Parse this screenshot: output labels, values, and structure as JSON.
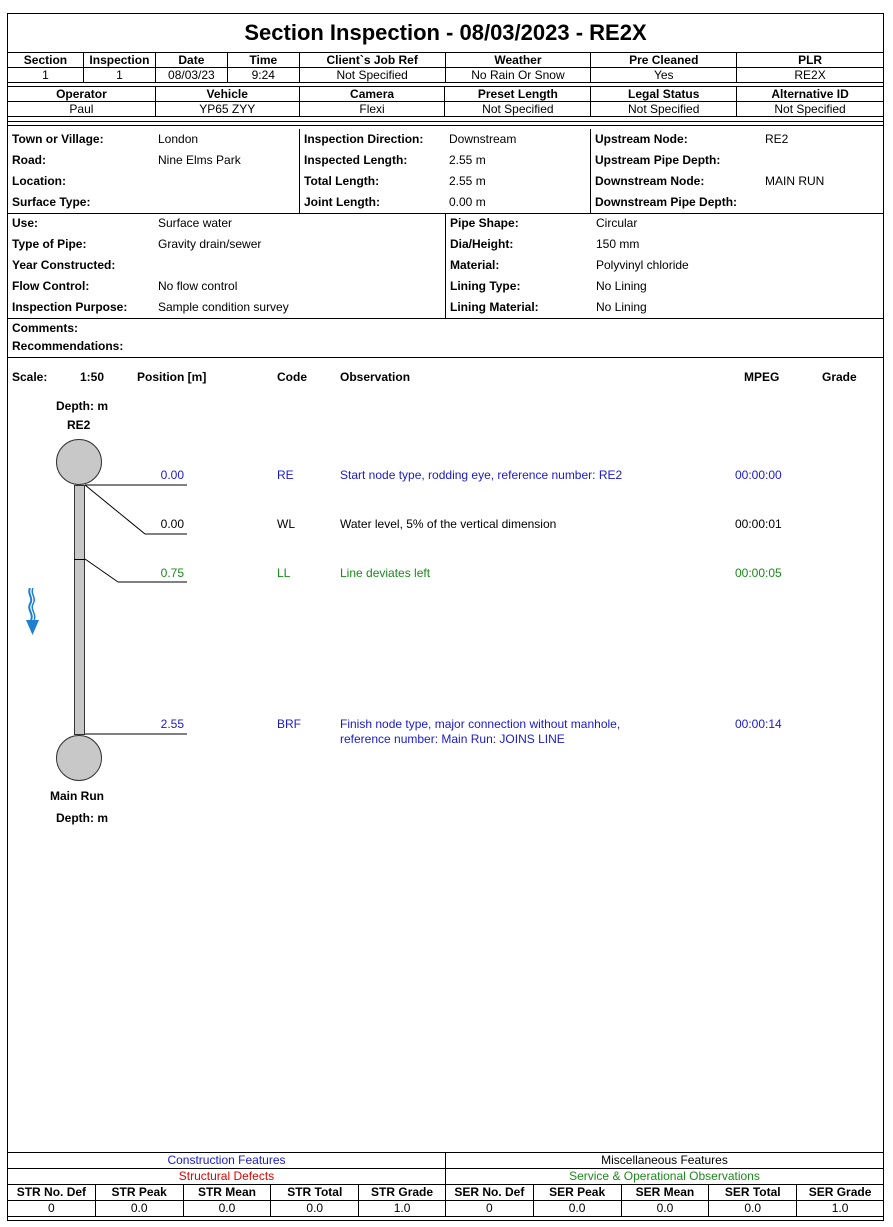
{
  "title": "Section Inspection - 08/03/2023 - RE2X",
  "header_row1": {
    "labels": [
      "Section",
      "Inspection",
      "Date",
      "Time",
      "Client`s Job Ref",
      "Weather",
      "Pre Cleaned",
      "PLR"
    ],
    "values": [
      "1",
      "1",
      "08/03/23",
      "9:24",
      "Not Specified",
      "No Rain Or Snow",
      "Yes",
      "RE2X"
    ]
  },
  "header_row2": {
    "labels": [
      "Operator",
      "Vehicle",
      "Camera",
      "Preset Length",
      "Legal Status",
      "Alternative ID"
    ],
    "values": [
      "Paul",
      "YP65 ZYY",
      "Flexi",
      "Not Specified",
      "Not Specified",
      "Not Specified"
    ]
  },
  "info1": {
    "col1": [
      {
        "label": "Town or Village:",
        "value": "London"
      },
      {
        "label": "Road:",
        "value": "Nine Elms Park"
      },
      {
        "label": "Location:",
        "value": ""
      },
      {
        "label": "Surface Type:",
        "value": ""
      }
    ],
    "col2": [
      {
        "label": "Inspection Direction:",
        "value": "Downstream"
      },
      {
        "label": "Inspected Length:",
        "value": "2.55 m"
      },
      {
        "label": "Total Length:",
        "value": "2.55 m"
      },
      {
        "label": "Joint Length:",
        "value": "0.00 m"
      }
    ],
    "col3": [
      {
        "label": "Upstream Node:",
        "value": "RE2"
      },
      {
        "label": "Upstream Pipe Depth:",
        "value": ""
      },
      {
        "label": "Downstream Node:",
        "value": "MAIN RUN"
      },
      {
        "label": "Downstream Pipe Depth:",
        "value": ""
      }
    ]
  },
  "info2": {
    "col1": [
      {
        "label": "Use:",
        "value": "Surface water"
      },
      {
        "label": "Type of Pipe:",
        "value": "Gravity drain/sewer"
      },
      {
        "label": "Year Constructed:",
        "value": ""
      },
      {
        "label": "Flow Control:",
        "value": "No flow control"
      },
      {
        "label": "Inspection Purpose:",
        "value": "Sample condition survey"
      }
    ],
    "col2": [
      {
        "label": "Pipe Shape:",
        "value": "Circular"
      },
      {
        "label": "Dia/Height:",
        "value": "150 mm"
      },
      {
        "label": "Material:",
        "value": "Polyvinyl chloride"
      },
      {
        "label": "Lining Type:",
        "value": "No Lining"
      },
      {
        "label": "Lining Material:",
        "value": "No Lining"
      }
    ]
  },
  "comments_label": "Comments:",
  "recommendations_label": "Recommendations:",
  "obs_header": {
    "scale_label": "Scale:",
    "scale_value": "1:50",
    "position": "Position [m]",
    "code": "Code",
    "observation": "Observation",
    "mpeg": "MPEG",
    "grade": "Grade"
  },
  "start_node": {
    "depth_label": "Depth: m",
    "name": "RE2"
  },
  "end_node": {
    "name": "Main Run",
    "depth_label": "Depth: m"
  },
  "observations": [
    {
      "position": "0.00",
      "code": "RE",
      "text": "Start node type, rodding eye, reference number: RE2",
      "text2": "",
      "mpeg": "00:00:00",
      "color": "#1a1acc"
    },
    {
      "position": "0.00",
      "code": "WL",
      "text": "Water level, 5% of the vertical dimension",
      "text2": "",
      "mpeg": "00:00:01",
      "color": "#000000"
    },
    {
      "position": "0.75",
      "code": "LL",
      "text": "Line deviates left",
      "text2": "",
      "mpeg": "00:00:05",
      "color": "#1a8a1a"
    },
    {
      "position": "2.55",
      "code": "BRF",
      "text": "Finish node type, major connection without manhole,",
      "text2": "reference number: Main Run: JOINS LINE",
      "mpeg": "00:00:14",
      "color": "#1a1acc"
    }
  ],
  "footer": {
    "construction_features": "Construction Features",
    "structural_defects": "Structural Defects",
    "misc_features": "Miscellaneous Features",
    "service_observations": "Service & Operational Observations",
    "labels": [
      "STR No. Def",
      "STR Peak",
      "STR Mean",
      "STR Total",
      "STR Grade",
      "SER No. Def",
      "SER Peak",
      "SER Mean",
      "SER Total",
      "SER Grade"
    ],
    "values": [
      "0",
      "0.0",
      "0.0",
      "0.0",
      "1.0",
      "0",
      "0.0",
      "0.0",
      "0.0",
      "1.0"
    ]
  },
  "colors": {
    "blue": "#1a1acc",
    "green": "#1a8a1a",
    "red": "#e00000",
    "flow_arrow": "#1f7fd0"
  },
  "icons": {
    "flow_direction": "flow-arrow-down-icon"
  }
}
